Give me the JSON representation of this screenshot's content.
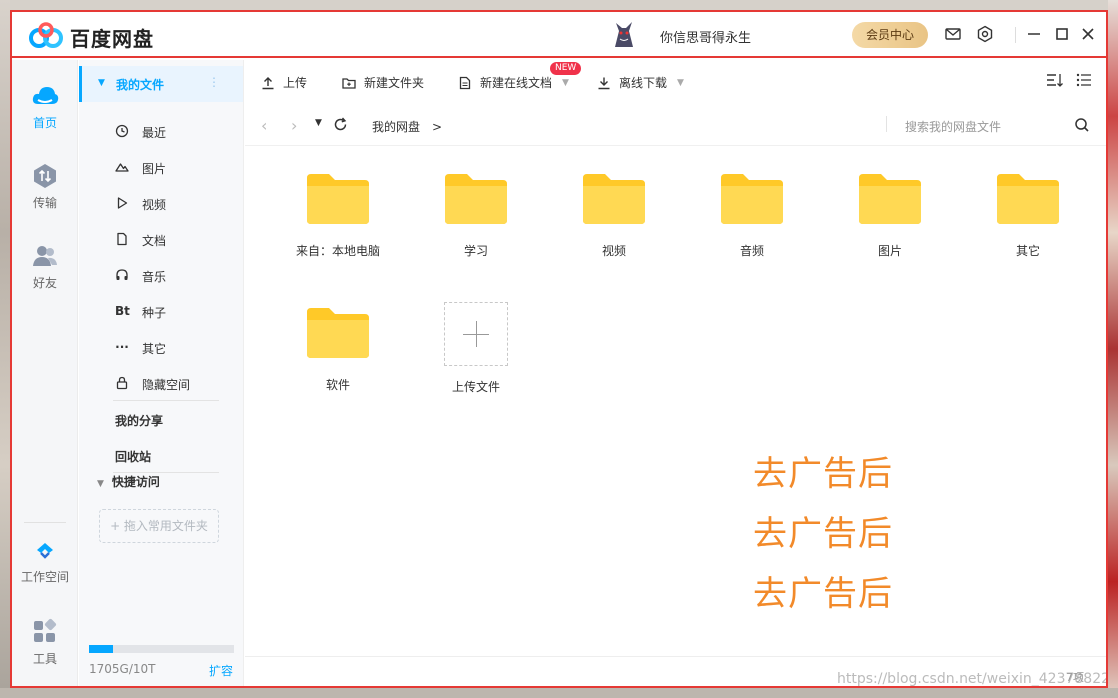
{
  "app": {
    "title": "百度网盘",
    "username": "你信思哥得永生",
    "vip_label": "会员中心"
  },
  "rail": {
    "items": [
      {
        "label": "首页",
        "active": true
      },
      {
        "label": "传输"
      },
      {
        "label": "好友"
      },
      {
        "label": "工作空间"
      },
      {
        "label": "工具"
      }
    ]
  },
  "sidebar": {
    "my_files": "我的文件",
    "more": "⋮",
    "items": [
      {
        "label": "最近",
        "icon": "clock-icon"
      },
      {
        "label": "图片",
        "icon": "image-icon"
      },
      {
        "label": "视频",
        "icon": "play-icon"
      },
      {
        "label": "文档",
        "icon": "document-icon"
      },
      {
        "label": "音乐",
        "icon": "headphones-icon"
      },
      {
        "label": "种子",
        "icon": "bt-icon",
        "glyph": "Bt"
      },
      {
        "label": "其它",
        "icon": "more-icon",
        "glyph": "···"
      },
      {
        "label": "隐藏空间",
        "icon": "lock-icon"
      }
    ],
    "my_share": "我的分享",
    "recycle": "回收站",
    "quick_access": "快捷访问",
    "drop_hint": "+ 拖入常用文件夹",
    "quota_text": "1705G/10T",
    "quota_used_fraction": 0.167,
    "expand": "扩容"
  },
  "toolbar": {
    "upload": "上传",
    "new_folder": "新建文件夹",
    "new_online_doc": "新建在线文档",
    "new_badge": "NEW",
    "offline_download": "离线下载"
  },
  "address": {
    "path": "我的网盘",
    "path_sep": ">",
    "search_placeholder": "搜索我的网盘文件"
  },
  "files": [
    {
      "name": "来自：本地电脑"
    },
    {
      "name": "学习"
    },
    {
      "name": "视频"
    },
    {
      "name": "音频"
    },
    {
      "name": "图片"
    },
    {
      "name": "其它"
    },
    {
      "name": "软件"
    }
  ],
  "upload_tile_label": "上传文件",
  "ad_text": [
    "去广告后",
    "去广告后",
    "去广告后"
  ],
  "status": {
    "count": "7项",
    "watermark": "https://blog.csdn.net/weixin_42378822"
  },
  "colors": {
    "accent": "#06a7ff",
    "highlight_border": "#e53935",
    "folder": "#ffd54f",
    "ad_text": "#f28a2a"
  }
}
